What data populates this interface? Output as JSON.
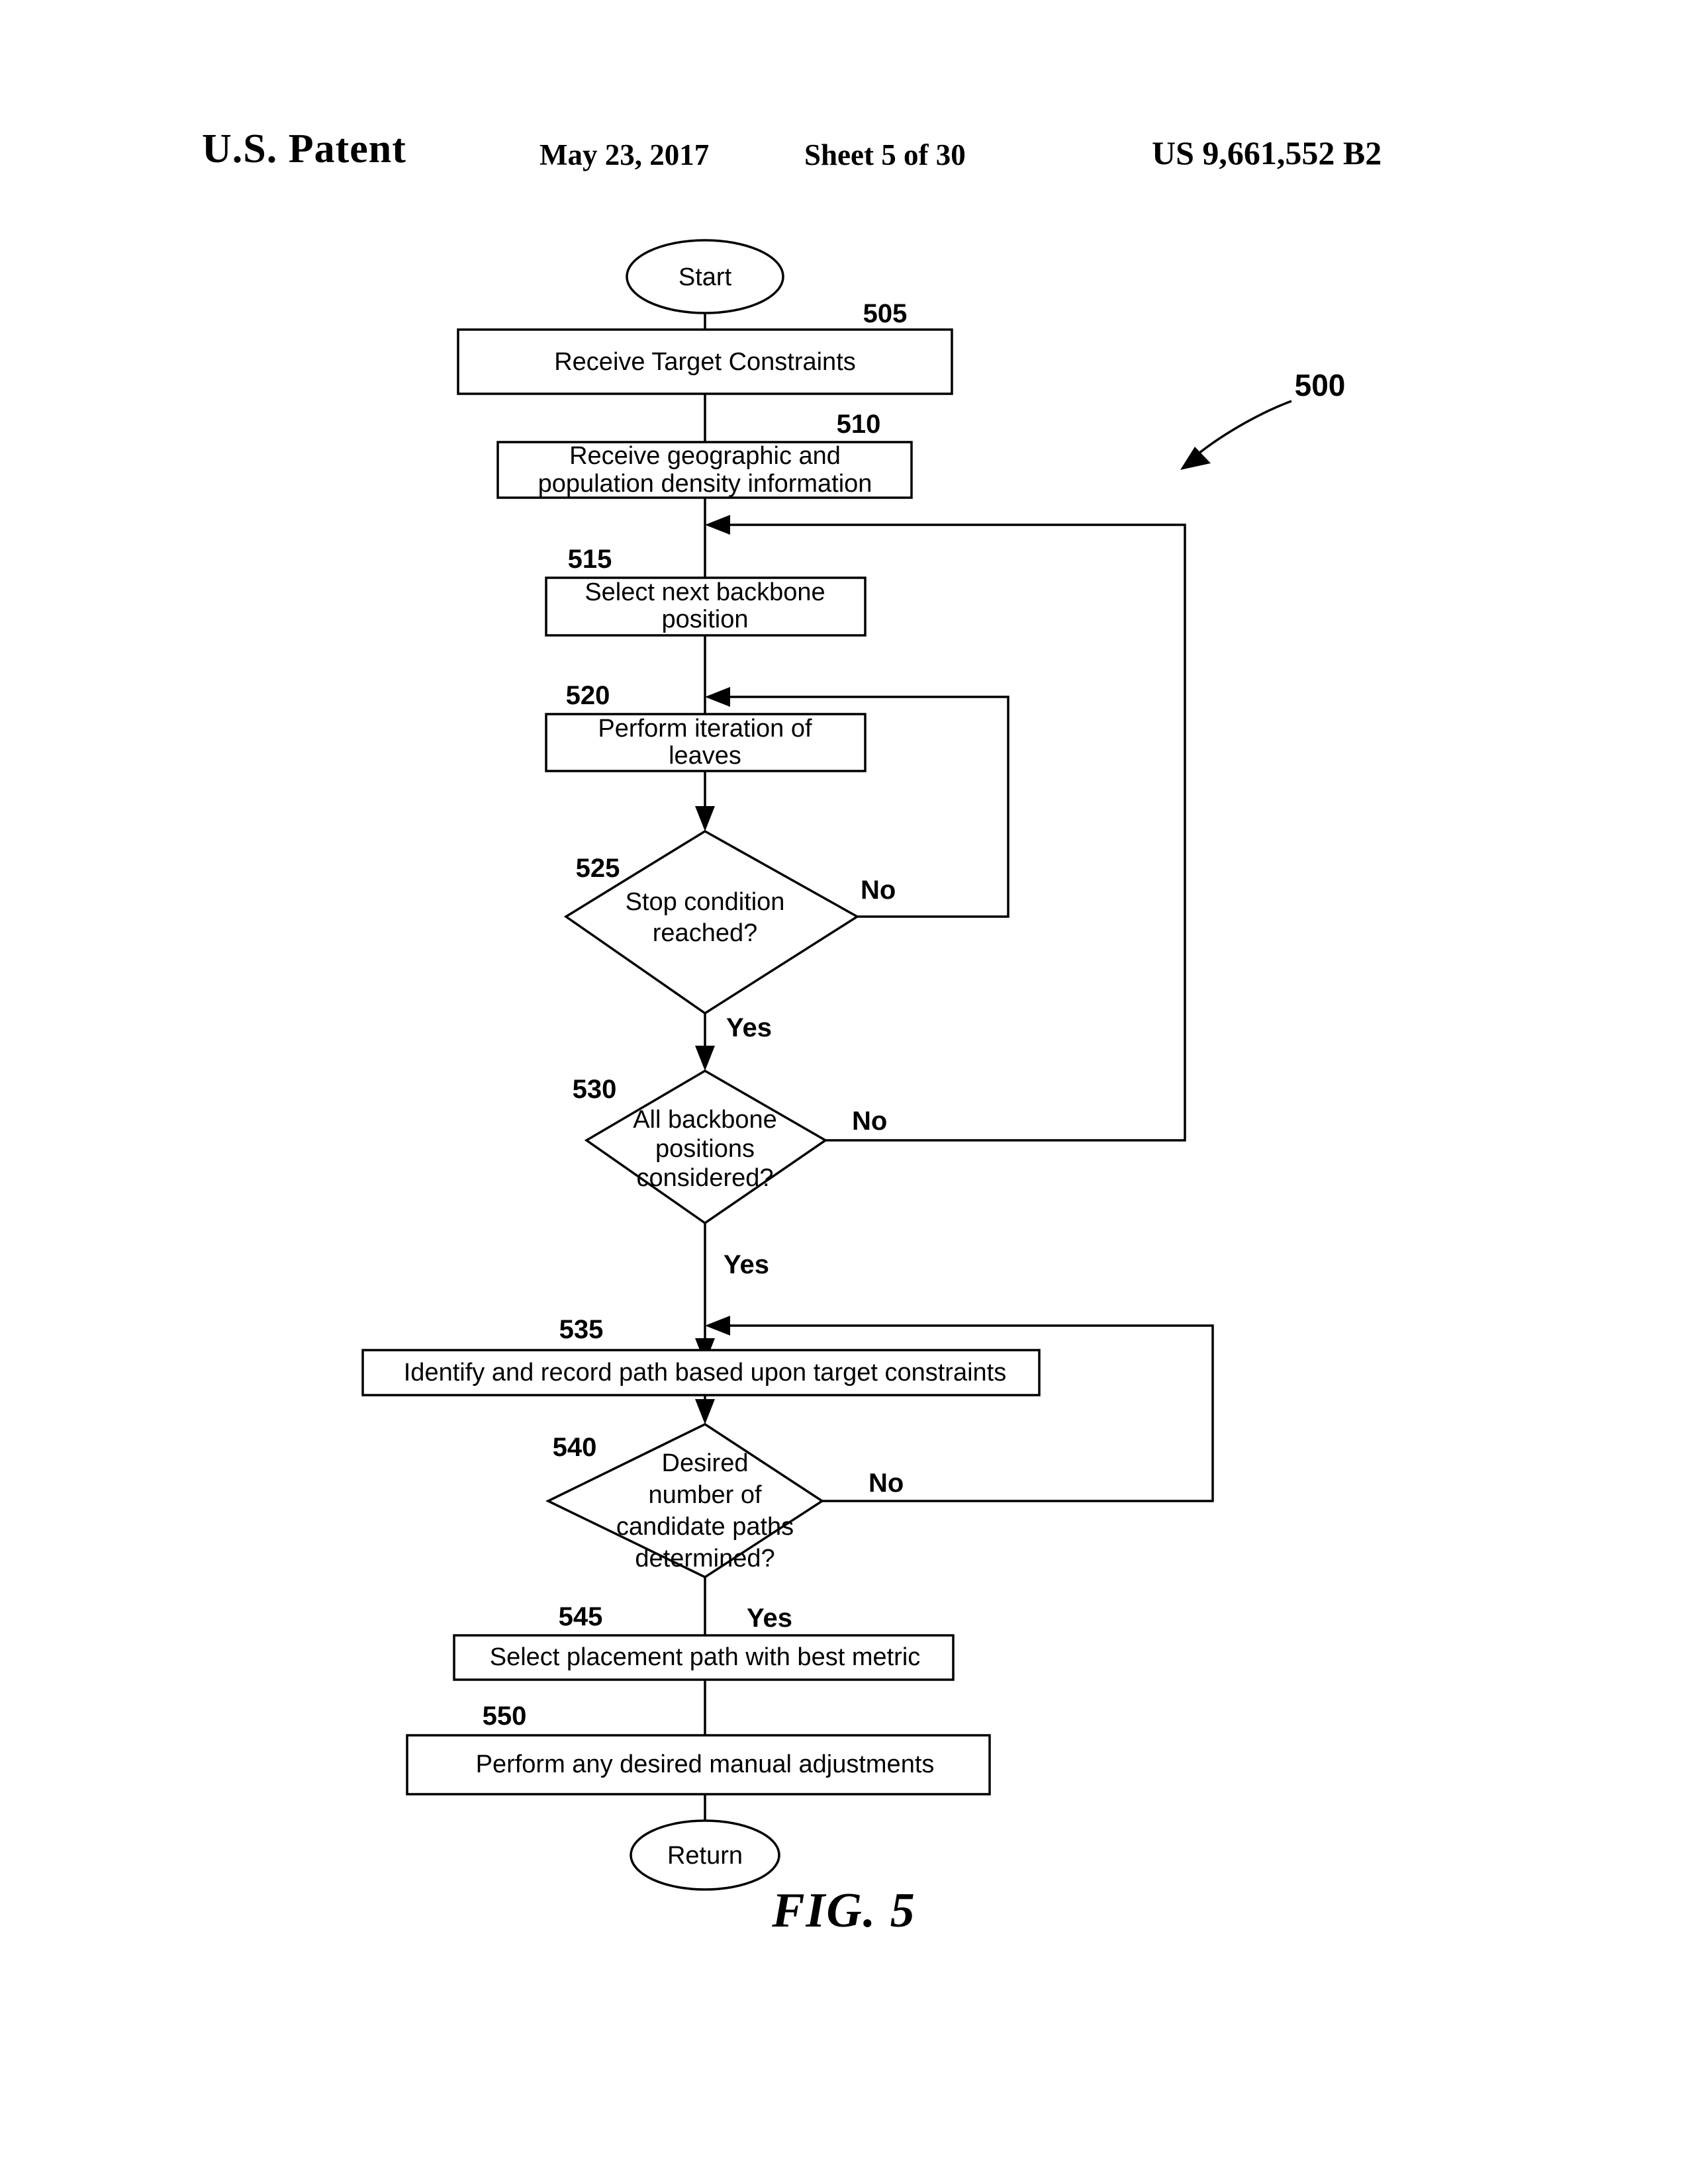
{
  "header": {
    "office": "U.S. Patent",
    "date": "May 23, 2017",
    "sheet": "Sheet 5 of 30",
    "patent_number": "US 9,661,552 B2"
  },
  "figure": {
    "caption": "FIG. 5",
    "diagram_ref": "500"
  },
  "nodes": {
    "start": {
      "ref": "",
      "label": "Start"
    },
    "n505": {
      "ref": "505",
      "label": "Receive Target Constraints"
    },
    "n510": {
      "ref": "510",
      "line1": "Receive geographic and",
      "line2": "population density information"
    },
    "n515": {
      "ref": "515",
      "line1": "Select next backbone",
      "line2": "position"
    },
    "n520": {
      "ref": "520",
      "line1": "Perform iteration of",
      "line2": "leaves"
    },
    "n525": {
      "ref": "525",
      "line1": "Stop condition",
      "line2": "reached?"
    },
    "n530": {
      "ref": "530",
      "line1": "All backbone",
      "line2": "positions",
      "line3": "considered?"
    },
    "n535": {
      "ref": "535",
      "label": "Identify and record path based upon target constraints"
    },
    "n540": {
      "ref": "540",
      "line1": "Desired",
      "line2": "number of",
      "line3": "candidate paths",
      "line4": "determined?"
    },
    "n545": {
      "ref": "545",
      "label": "Select placement path with best metric"
    },
    "n550": {
      "ref": "550",
      "label": "Perform any desired manual adjustments"
    },
    "return": {
      "ref": "",
      "label": "Return"
    }
  },
  "branches": {
    "b525_no": "No",
    "b525_yes": "Yes",
    "b530_no": "No",
    "b530_yes": "Yes",
    "b540_no": "No",
    "b540_yes": "Yes"
  },
  "colors": {
    "ink": "#000000",
    "paper": "#ffffff"
  }
}
